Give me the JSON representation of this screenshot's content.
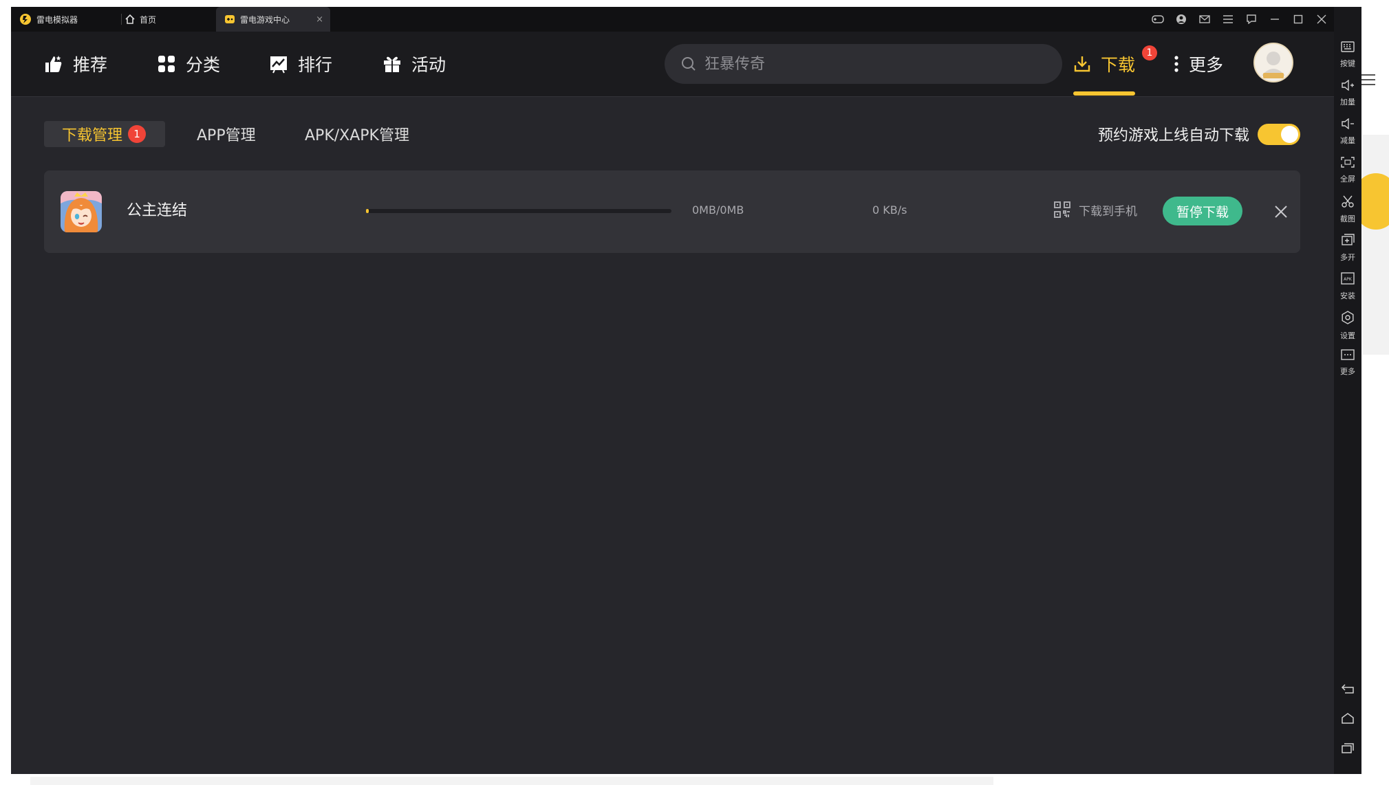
{
  "titlebar": {
    "tabs": [
      {
        "label": "雷电模拟器"
      },
      {
        "label": "首页"
      },
      {
        "label": "雷电游戏中心"
      }
    ]
  },
  "sidebar": {
    "items": [
      {
        "label": "按键",
        "icon": "keyboard-icon"
      },
      {
        "label": "加量",
        "icon": "volume-up-icon"
      },
      {
        "label": "减量",
        "icon": "volume-down-icon"
      },
      {
        "label": "全屏",
        "icon": "fullscreen-icon"
      },
      {
        "label": "截图",
        "icon": "scissors-icon"
      },
      {
        "label": "多开",
        "icon": "multi-open-icon"
      },
      {
        "label": "安装",
        "icon": "apk-install-icon"
      },
      {
        "label": "设置",
        "icon": "settings-icon"
      },
      {
        "label": "更多",
        "icon": "more-icon"
      }
    ]
  },
  "nav": {
    "recommend": "推荐",
    "category": "分类",
    "ranking": "排行",
    "activity": "活动",
    "download": "下载",
    "download_badge": "1",
    "more": "更多"
  },
  "search": {
    "placeholder": "狂暴传奇"
  },
  "subtabs": {
    "download_mgmt": "下载管理",
    "download_badge": "1",
    "app_mgmt": "APP管理",
    "apk_mgmt": "APK/XAPK管理"
  },
  "auto_download": {
    "label": "预约游戏上线自动下载",
    "enabled": true
  },
  "downloads": [
    {
      "name": "公主连结",
      "progress": 0.01,
      "size": "0MB/0MB",
      "speed": "0 KB/s",
      "to_phone_label": "下载到手机",
      "pause_label": "暂停下载"
    }
  ],
  "colors": {
    "accent": "#f7c531",
    "badge": "#f04438",
    "pause_button": "#3fb98c",
    "background": "#26262b",
    "nav_background": "#1b1b1e",
    "row_background": "#333338"
  }
}
